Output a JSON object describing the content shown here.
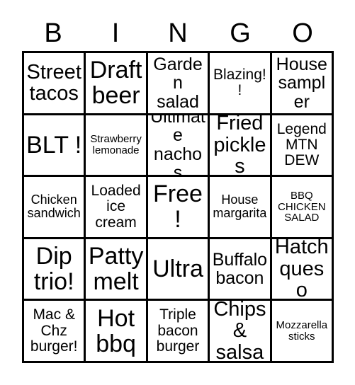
{
  "card": {
    "type": "bingo-card",
    "columns": 5,
    "rows": 5,
    "text_color": "#000000",
    "background_color": "#ffffff",
    "border_color": "#000000"
  },
  "header": {
    "letters": [
      "B",
      "I",
      "N",
      "G",
      "O"
    ]
  },
  "grid": {
    "rows": [
      [
        {
          "text": "Street\ntacos",
          "size": "fs-xl"
        },
        {
          "text": "Draft\nbeer",
          "size": "fs-xxl"
        },
        {
          "text": "Garden\nsalad",
          "size": "fs-lg"
        },
        {
          "text": "Blazing!!",
          "size": "fs-md"
        },
        {
          "text": "House\nsampler",
          "size": "fs-lg"
        }
      ],
      [
        {
          "text": "BLT !",
          "size": "fs-xxl"
        },
        {
          "text": "Strawberry\nlemonade",
          "size": "fs-xs"
        },
        {
          "text": "Ultimate\nnachos",
          "size": "fs-lg"
        },
        {
          "text": "Fried\npickles",
          "size": "fs-xl"
        },
        {
          "text": "Legend\nMTN\nDEW",
          "size": "fs-md"
        }
      ],
      [
        {
          "text": "Chicken\nsandwich",
          "size": "fs-sm"
        },
        {
          "text": "Loaded\nice\ncream",
          "size": "fs-md"
        },
        {
          "text": "Free!",
          "size": "fs-xxl"
        },
        {
          "text": "House\nmargarita",
          "size": "fs-sm"
        },
        {
          "text": "BBQ\nCHICKEN\nSALAD",
          "size": "fs-xs"
        }
      ],
      [
        {
          "text": "Dip\ntrio!",
          "size": "fs-xxl"
        },
        {
          "text": "Patty\nmelt",
          "size": "fs-xxl"
        },
        {
          "text": "Ultra",
          "size": "fs-xxl"
        },
        {
          "text": "Buffalo\nbacon",
          "size": "fs-lg"
        },
        {
          "text": "Hatch\nqueso",
          "size": "fs-xl"
        }
      ],
      [
        {
          "text": "Mac &\nChz\nburger!",
          "size": "fs-md"
        },
        {
          "text": "Hot\nbbq",
          "size": "fs-xxl"
        },
        {
          "text": "Triple\nbacon\nburger",
          "size": "fs-md"
        },
        {
          "text": "Chips\n& salsa",
          "size": "fs-xl"
        },
        {
          "text": "Mozzarella\nsticks",
          "size": "fs-xs"
        }
      ]
    ]
  }
}
